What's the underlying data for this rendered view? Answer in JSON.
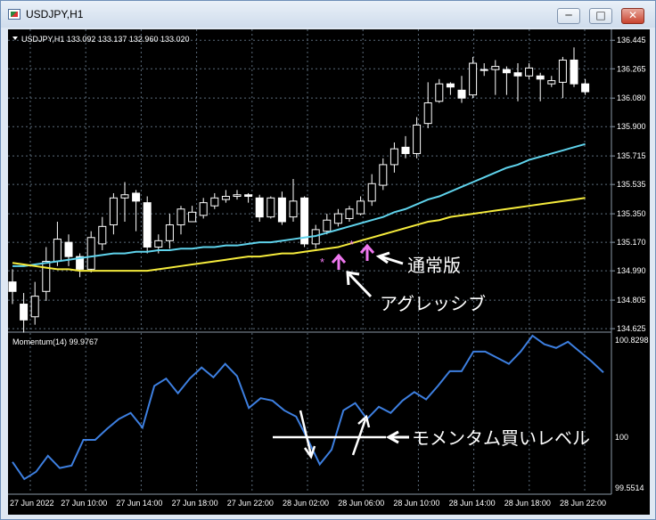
{
  "window": {
    "title": "USDJPY,H1",
    "buttons": {
      "minimize": "─",
      "maximize": "□",
      "close": "✕"
    },
    "icon": "chart-app-icon"
  },
  "main_panel": {
    "info_label": "USDJPY,H1  133.092 133.137 132.960 133.020",
    "price_labels": [
      "136.445",
      "136.265",
      "136.080",
      "135.900",
      "135.715",
      "135.535",
      "135.350",
      "135.170",
      "134.990",
      "134.805",
      "134.625"
    ]
  },
  "sub_panel": {
    "info_label": "Momentum(14) 99.9767",
    "value_labels": [
      "100.8298",
      "100",
      "99.5514"
    ]
  },
  "time_labels": [
    "27 Jun 2022",
    "27 Jun 10:00",
    "27 Jun 14:00",
    "27 Jun 18:00",
    "27 Jun 22:00",
    "28 Jun 02:00",
    "28 Jun 06:00",
    "28 Jun 10:00",
    "28 Jun 14:00",
    "28 Jun 18:00",
    "28 Jun 22:00"
  ],
  "annotations": {
    "normal": "通常版",
    "aggressive": "アグレッシブ",
    "momentum_buy": "モメンタム買いレベル"
  },
  "colors": {
    "background": "#000000",
    "grid": "#5b6b7a",
    "candle": "#ffffff",
    "ma_fast": "#5fd3ec",
    "ma_slow": "#f5eb3c",
    "momentum": "#3d7fe0",
    "arrow": "#ee77ee",
    "text": "#ffffff"
  },
  "chart_data": [
    {
      "type": "candlestick",
      "title": "USDJPY,H1",
      "ohlc_info": {
        "open": 133.092,
        "high": 133.137,
        "low": 132.96,
        "close": 133.02
      },
      "y_ticks": [
        134.625,
        134.805,
        134.99,
        135.17,
        135.35,
        135.535,
        135.715,
        135.9,
        136.08,
        136.265,
        136.445
      ],
      "ylim": [
        134.62,
        136.48
      ],
      "x_ticks": [
        "27 Jun 2022",
        "27 Jun 10:00",
        "27 Jun 14:00",
        "27 Jun 18:00",
        "27 Jun 22:00",
        "28 Jun 02:00",
        "28 Jun 06:00",
        "28 Jun 10:00",
        "28 Jun 14:00",
        "28 Jun 18:00",
        "28 Jun 22:00"
      ],
      "candles": [
        [
          134.92,
          134.86,
          135.0,
          134.78
        ],
        [
          134.78,
          134.68,
          134.85,
          134.6
        ],
        [
          134.7,
          134.83,
          134.92,
          134.65
        ],
        [
          134.86,
          135.05,
          135.14,
          134.8
        ],
        [
          135.05,
          135.19,
          135.3,
          135.02
        ],
        [
          135.17,
          135.08,
          135.22,
          135.02
        ],
        [
          135.08,
          135.0,
          135.1,
          134.95
        ],
        [
          135.0,
          135.2,
          135.24,
          134.98
        ],
        [
          135.16,
          135.27,
          135.33,
          135.12
        ],
        [
          135.28,
          135.45,
          135.48,
          135.22
        ],
        [
          135.45,
          135.47,
          135.55,
          135.3
        ],
        [
          135.48,
          135.43,
          135.5,
          135.24
        ],
        [
          135.42,
          135.14,
          135.46,
          135.1
        ],
        [
          135.14,
          135.18,
          135.22,
          135.1
        ],
        [
          135.18,
          135.28,
          135.35,
          135.13
        ],
        [
          135.28,
          135.38,
          135.4,
          135.22
        ],
        [
          135.3,
          135.36,
          135.4,
          135.3
        ],
        [
          135.34,
          135.42,
          135.45,
          135.32
        ],
        [
          135.4,
          135.45,
          135.48,
          135.38
        ],
        [
          135.44,
          135.46,
          135.5,
          135.42
        ],
        [
          135.46,
          135.47,
          135.5,
          135.44
        ],
        [
          135.47,
          135.46,
          135.48,
          135.42
        ],
        [
          135.45,
          135.33,
          135.47,
          135.3
        ],
        [
          135.33,
          135.45,
          135.46,
          135.32
        ],
        [
          135.45,
          135.3,
          135.49,
          135.28
        ],
        [
          135.33,
          135.43,
          135.57,
          135.3
        ],
        [
          135.45,
          135.16,
          135.46,
          135.14
        ],
        [
          135.16,
          135.25,
          135.28,
          135.13
        ],
        [
          135.24,
          135.31,
          135.35,
          135.22
        ],
        [
          135.29,
          135.35,
          135.38,
          135.27
        ],
        [
          135.32,
          135.38,
          135.4,
          135.3
        ],
        [
          135.35,
          135.43,
          135.46,
          135.34
        ],
        [
          135.43,
          135.54,
          135.6,
          135.4
        ],
        [
          135.53,
          135.66,
          135.7,
          135.5
        ],
        [
          135.66,
          135.76,
          135.8,
          135.61
        ],
        [
          135.77,
          135.73,
          135.84,
          135.7
        ],
        [
          135.73,
          135.91,
          135.96,
          135.7
        ],
        [
          135.92,
          136.05,
          136.18,
          135.89
        ],
        [
          136.06,
          136.17,
          136.2,
          136.05
        ],
        [
          136.17,
          136.15,
          136.18,
          136.1
        ],
        [
          136.13,
          136.08,
          136.22,
          136.05
        ],
        [
          136.1,
          136.3,
          136.34,
          136.08
        ],
        [
          136.26,
          136.26,
          136.3,
          136.22
        ],
        [
          136.26,
          136.28,
          136.32,
          136.1
        ],
        [
          136.26,
          136.24,
          136.28,
          136.1
        ],
        [
          136.24,
          136.22,
          136.3,
          136.06
        ],
        [
          136.22,
          136.27,
          136.3,
          136.2
        ],
        [
          136.22,
          136.2,
          136.24,
          136.06
        ],
        [
          136.17,
          136.19,
          136.22,
          136.15
        ],
        [
          136.18,
          136.32,
          136.34,
          136.08
        ],
        [
          136.32,
          136.17,
          136.4,
          136.15
        ],
        [
          136.17,
          136.12,
          136.2,
          136.1
        ]
      ],
      "series": [
        {
          "name": "ma_fast",
          "values": [
            135.02,
            135.02,
            135.03,
            135.04,
            135.05,
            135.06,
            135.07,
            135.08,
            135.09,
            135.1,
            135.1,
            135.11,
            135.11,
            135.12,
            135.12,
            135.13,
            135.13,
            135.14,
            135.14,
            135.15,
            135.15,
            135.16,
            135.17,
            135.17,
            135.18,
            135.19,
            135.2,
            135.21,
            135.23,
            135.25,
            135.27,
            135.29,
            135.31,
            135.33,
            135.36,
            135.38,
            135.41,
            135.44,
            135.46,
            135.49,
            135.52,
            135.55,
            135.58,
            135.61,
            135.64,
            135.66,
            135.69,
            135.71,
            135.73,
            135.75,
            135.77,
            135.79
          ]
        },
        {
          "name": "ma_slow",
          "values": [
            135.04,
            135.03,
            135.02,
            135.01,
            135.0,
            135.0,
            134.99,
            134.99,
            134.99,
            134.99,
            134.99,
            134.99,
            134.99,
            135.0,
            135.01,
            135.02,
            135.03,
            135.04,
            135.05,
            135.06,
            135.07,
            135.08,
            135.08,
            135.09,
            135.1,
            135.1,
            135.11,
            135.12,
            135.13,
            135.14,
            135.16,
            135.18,
            135.2,
            135.22,
            135.24,
            135.26,
            135.28,
            135.3,
            135.31,
            135.33,
            135.34,
            135.35,
            135.36,
            135.37,
            135.38,
            135.39,
            135.4,
            135.41,
            135.42,
            135.43,
            135.44,
            135.45
          ]
        }
      ]
    },
    {
      "type": "line",
      "title": "Momentum(14) 99.9767",
      "ylim": [
        99.5514,
        100.8298
      ],
      "y_ticks": [
        99.5514,
        100,
        100.8298
      ],
      "series": [
        {
          "name": "Momentum(14)",
          "values": [
            99.8,
            99.66,
            99.72,
            99.85,
            99.75,
            99.77,
            99.98,
            99.98,
            100.07,
            100.15,
            100.2,
            100.08,
            100.42,
            100.48,
            100.36,
            100.48,
            100.57,
            100.49,
            100.6,
            100.5,
            100.24,
            100.32,
            100.3,
            100.22,
            100.17,
            99.98,
            99.78,
            99.9,
            100.22,
            100.28,
            100.15,
            100.25,
            100.2,
            100.3,
            100.37,
            100.31,
            100.42,
            100.54,
            100.54,
            100.7,
            100.7,
            100.65,
            100.6,
            100.7,
            100.83,
            100.76,
            100.73,
            100.78,
            100.7,
            100.62,
            100.53
          ]
        }
      ]
    }
  ]
}
